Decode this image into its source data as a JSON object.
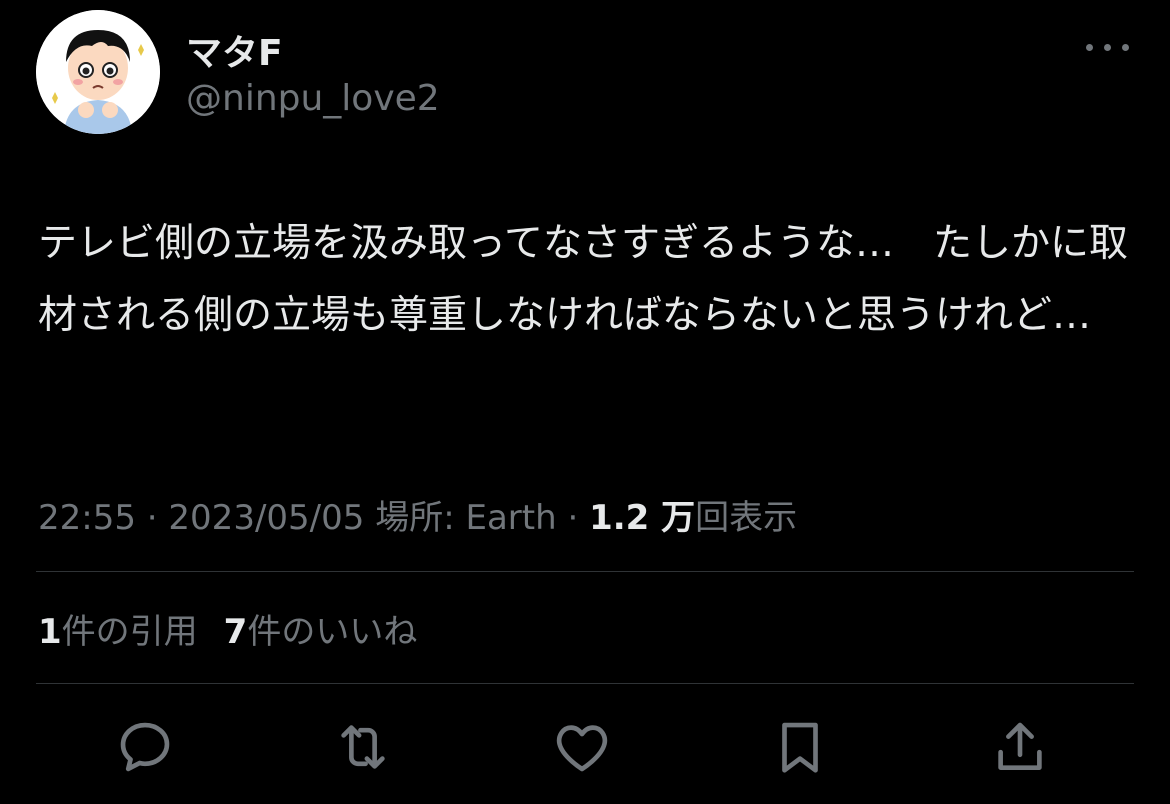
{
  "author": {
    "display_name": "マタF",
    "handle": "@ninpu_love2"
  },
  "tweet": {
    "text": "テレビ側の立場を汲み取ってなさすぎるような…　たしかに取材される側の立場も尊重しなければならないと思うけれど…"
  },
  "meta": {
    "time": "22:55",
    "sep1": " · ",
    "date": "2023/05/05",
    "location_label": " 場所: ",
    "location": "Earth",
    "sep2": " · ",
    "views_count": "1.2 万",
    "views_label": "回表示"
  },
  "stats": {
    "quotes_count": "1",
    "quotes_label": "件の引用",
    "likes_count": "7",
    "likes_label": "件のいいね"
  },
  "actions": {
    "reply_icon": "reply-icon",
    "retweet_icon": "retweet-icon",
    "like_icon": "heart-icon",
    "bookmark_icon": "bookmark-icon",
    "share_icon": "share-icon"
  },
  "colors": {
    "background": "#000000",
    "text": "#e7e9ea",
    "muted": "#71767b",
    "divider": "#2f3336"
  }
}
